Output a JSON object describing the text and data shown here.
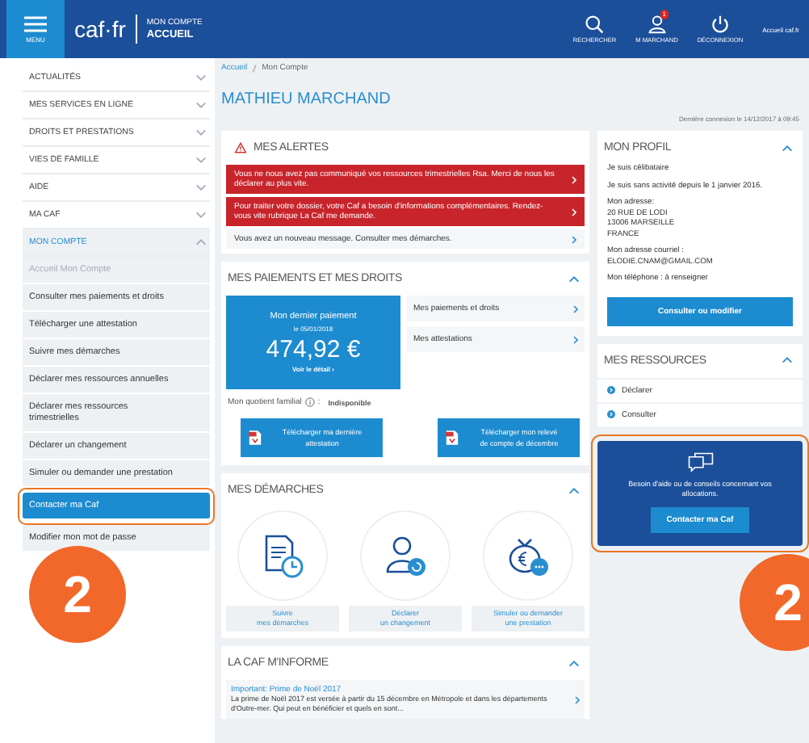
{
  "header": {
    "menu_label": "MENU",
    "logo": "caf·fr",
    "section": "MON COMPTE",
    "page": "ACCUEIL",
    "actions": [
      {
        "kind": "search",
        "label": "RECHERCHER"
      },
      {
        "kind": "user",
        "label": "M MARCHAND",
        "badge": "1"
      },
      {
        "kind": "power",
        "label": "DÉCONNEXION"
      }
    ],
    "site_link": "Accueil caf.fr"
  },
  "sidebar": {
    "items": [
      {
        "label": "ACTUALITÉS",
        "expanded": false
      },
      {
        "label": "MES SERVICES EN LIGNE",
        "expanded": false
      },
      {
        "label": "DROITS ET PRESTATIONS",
        "expanded": false
      },
      {
        "label": "VIES DE FAMILLE",
        "expanded": false
      },
      {
        "label": "AIDE",
        "expanded": false
      },
      {
        "label": "MA CAF",
        "expanded": false
      },
      {
        "label": "MON COMPTE",
        "expanded": true,
        "children": [
          {
            "label": "Accueil Mon Compte",
            "disabled": true,
            "selected": false,
            "highlighted": false
          },
          {
            "label": "Consulter mes paiements et droits",
            "disabled": false,
            "selected": false,
            "highlighted": false
          },
          {
            "label": "Télécharger une attestation",
            "disabled": false,
            "selected": false,
            "highlighted": false
          },
          {
            "label": "Suivre mes démarches",
            "disabled": false,
            "selected": false,
            "highlighted": false
          },
          {
            "label": "Déclarer mes ressources annuelles",
            "disabled": false,
            "selected": false,
            "highlighted": false
          },
          {
            "label": "Déclarer mes ressources trimestrielles",
            "disabled": false,
            "selected": false,
            "highlighted": false
          },
          {
            "label": "Déclarer un changement",
            "disabled": false,
            "selected": false,
            "highlighted": false
          },
          {
            "label": "Simuler ou demander une prestation",
            "disabled": false,
            "selected": false,
            "highlighted": false
          },
          {
            "label": "Contacter ma Caf",
            "disabled": false,
            "selected": true,
            "highlighted": true
          },
          {
            "label": "Modifier mon mot de passe",
            "disabled": false,
            "selected": false,
            "highlighted": false
          }
        ]
      }
    ]
  },
  "breadcrumb": [
    "Accueil",
    "Mon Compte"
  ],
  "user_name": "MATHIEU MARCHAND",
  "last_login": "Dernière connexion le 14/12/2017 à 09:45",
  "alerts": {
    "title": "MES ALERTES",
    "items": [
      {
        "kind": "urgent",
        "text": "Vous ne nous avez pas communiqué vos ressources trimestrielles Rsa. Merci de nous les déclarer au plus vite."
      },
      {
        "kind": "urgent",
        "text": "Pour traiter votre dossier, votre Caf a besoin d'informations complémentaires. Rendez-vous vite rubrique La Caf me demande."
      },
      {
        "kind": "info",
        "text": "Vous avez un nouveau message. Consulter mes démarches."
      }
    ]
  },
  "payments": {
    "title": "MES PAIEMENTS ET MES DROITS",
    "expanded": true,
    "last_payment": {
      "label": "Mon dernier paiement",
      "date": "le 05/01/2018",
      "amount": "474,92 €",
      "link": "Voir le détail",
      "link_arrow": "›"
    },
    "links": [
      "Mes paiements et droits",
      "Mes attestations"
    ],
    "quotient_label": "Mon quotient familial",
    "quotient_separator": ":",
    "quotient_value": "Indisponible",
    "downloads": [
      [
        "Télécharger ma dernière",
        "attestation"
      ],
      [
        "Télécharger mon relevé",
        "de compte de décembre"
      ]
    ]
  },
  "demarches": {
    "title": "MES DÉMARCHES",
    "expanded": true,
    "items": [
      {
        "kind": "follow",
        "lines": [
          "Suivre",
          "mes démarches"
        ]
      },
      {
        "kind": "declare",
        "lines": [
          "Déclarer",
          "un changement"
        ]
      },
      {
        "kind": "simulate",
        "lines": [
          "Simuler ou demander",
          "une prestation"
        ]
      }
    ]
  },
  "news": {
    "title": "LA CAF M'INFORME",
    "expanded": true,
    "items": [
      {
        "title": "Important: Prime de Noël 2017",
        "text": "La prime de Noël 2017 est versée à partir du 15 décembre en Métropole et dans les départements d'Outre-mer. Qui peut en bénéficier et quels en sont..."
      }
    ]
  },
  "profile": {
    "title": "MON PROFIL",
    "expanded": true,
    "paragraphs": [
      [
        "Je suis célibataire"
      ],
      [
        "Je suis sans activité depuis le 1 janvier 2016."
      ],
      [
        "Mon adresse:",
        "20 RUE DE LODI",
        "13006 MARSEILLE",
        "FRANCE"
      ],
      [
        "Mon adresse courriel :",
        "ELODIE.CNAM@GMAIL.COM"
      ],
      [
        "Mon téléphone : à renseigner"
      ]
    ],
    "button": "Consulter ou modifier"
  },
  "resources": {
    "title": "MES RESSOURCES",
    "expanded": true,
    "items": [
      "Déclarer",
      "Consulter"
    ]
  },
  "help": {
    "text": "Besoin d'aide ou de conseils concernant vos allocations.",
    "button": "Contacter ma Caf",
    "highlighted": true
  },
  "annotations": [
    {
      "label": "2"
    },
    {
      "label": "2"
    }
  ]
}
